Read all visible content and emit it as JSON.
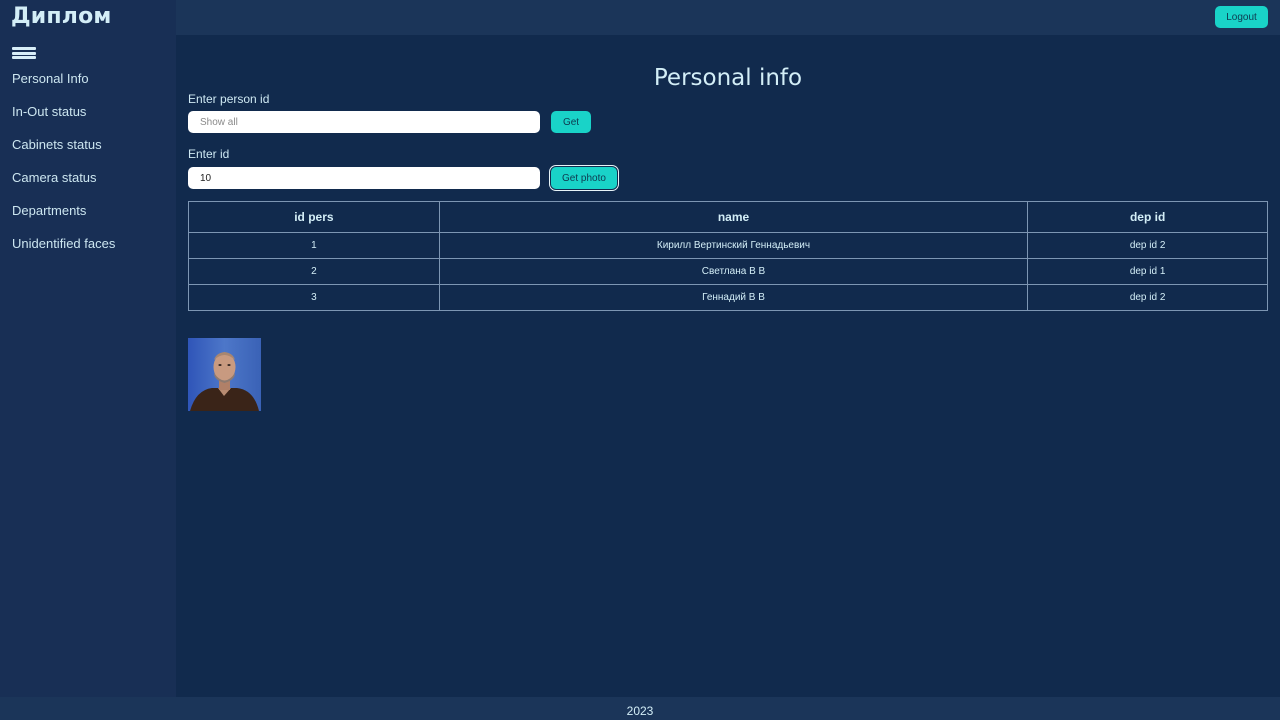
{
  "brand": "Диплом",
  "topbar": {
    "logout_label": "Logout"
  },
  "sidebar": {
    "items": [
      {
        "label": "Personal Info"
      },
      {
        "label": "In-Out status"
      },
      {
        "label": "Cabinets status"
      },
      {
        "label": "Camera status"
      },
      {
        "label": "Departments"
      },
      {
        "label": "Unidentified faces"
      }
    ]
  },
  "main": {
    "title": "Personal info",
    "person_id": {
      "label": "Enter person id",
      "placeholder": "Show all",
      "value": "",
      "button_label": "Get"
    },
    "photo_id": {
      "label": "Enter id",
      "value": "10",
      "button_label": "Get photo"
    },
    "table": {
      "headers": [
        "id pers",
        "name",
        "dep id"
      ],
      "rows": [
        [
          "1",
          "Кирилл Вертинский Геннадьевич",
          "dep id 2"
        ],
        [
          "2",
          "Светлана В В",
          "dep id 1"
        ],
        [
          "3",
          "Геннадий В В",
          "dep id 2"
        ]
      ]
    }
  },
  "footer": {
    "year": "2023"
  },
  "colors": {
    "background": "#112a4d",
    "sidebar": "#182f55",
    "topbar": "#1b3559",
    "accent": "#19d3c8",
    "text": "#cfe9f3"
  }
}
